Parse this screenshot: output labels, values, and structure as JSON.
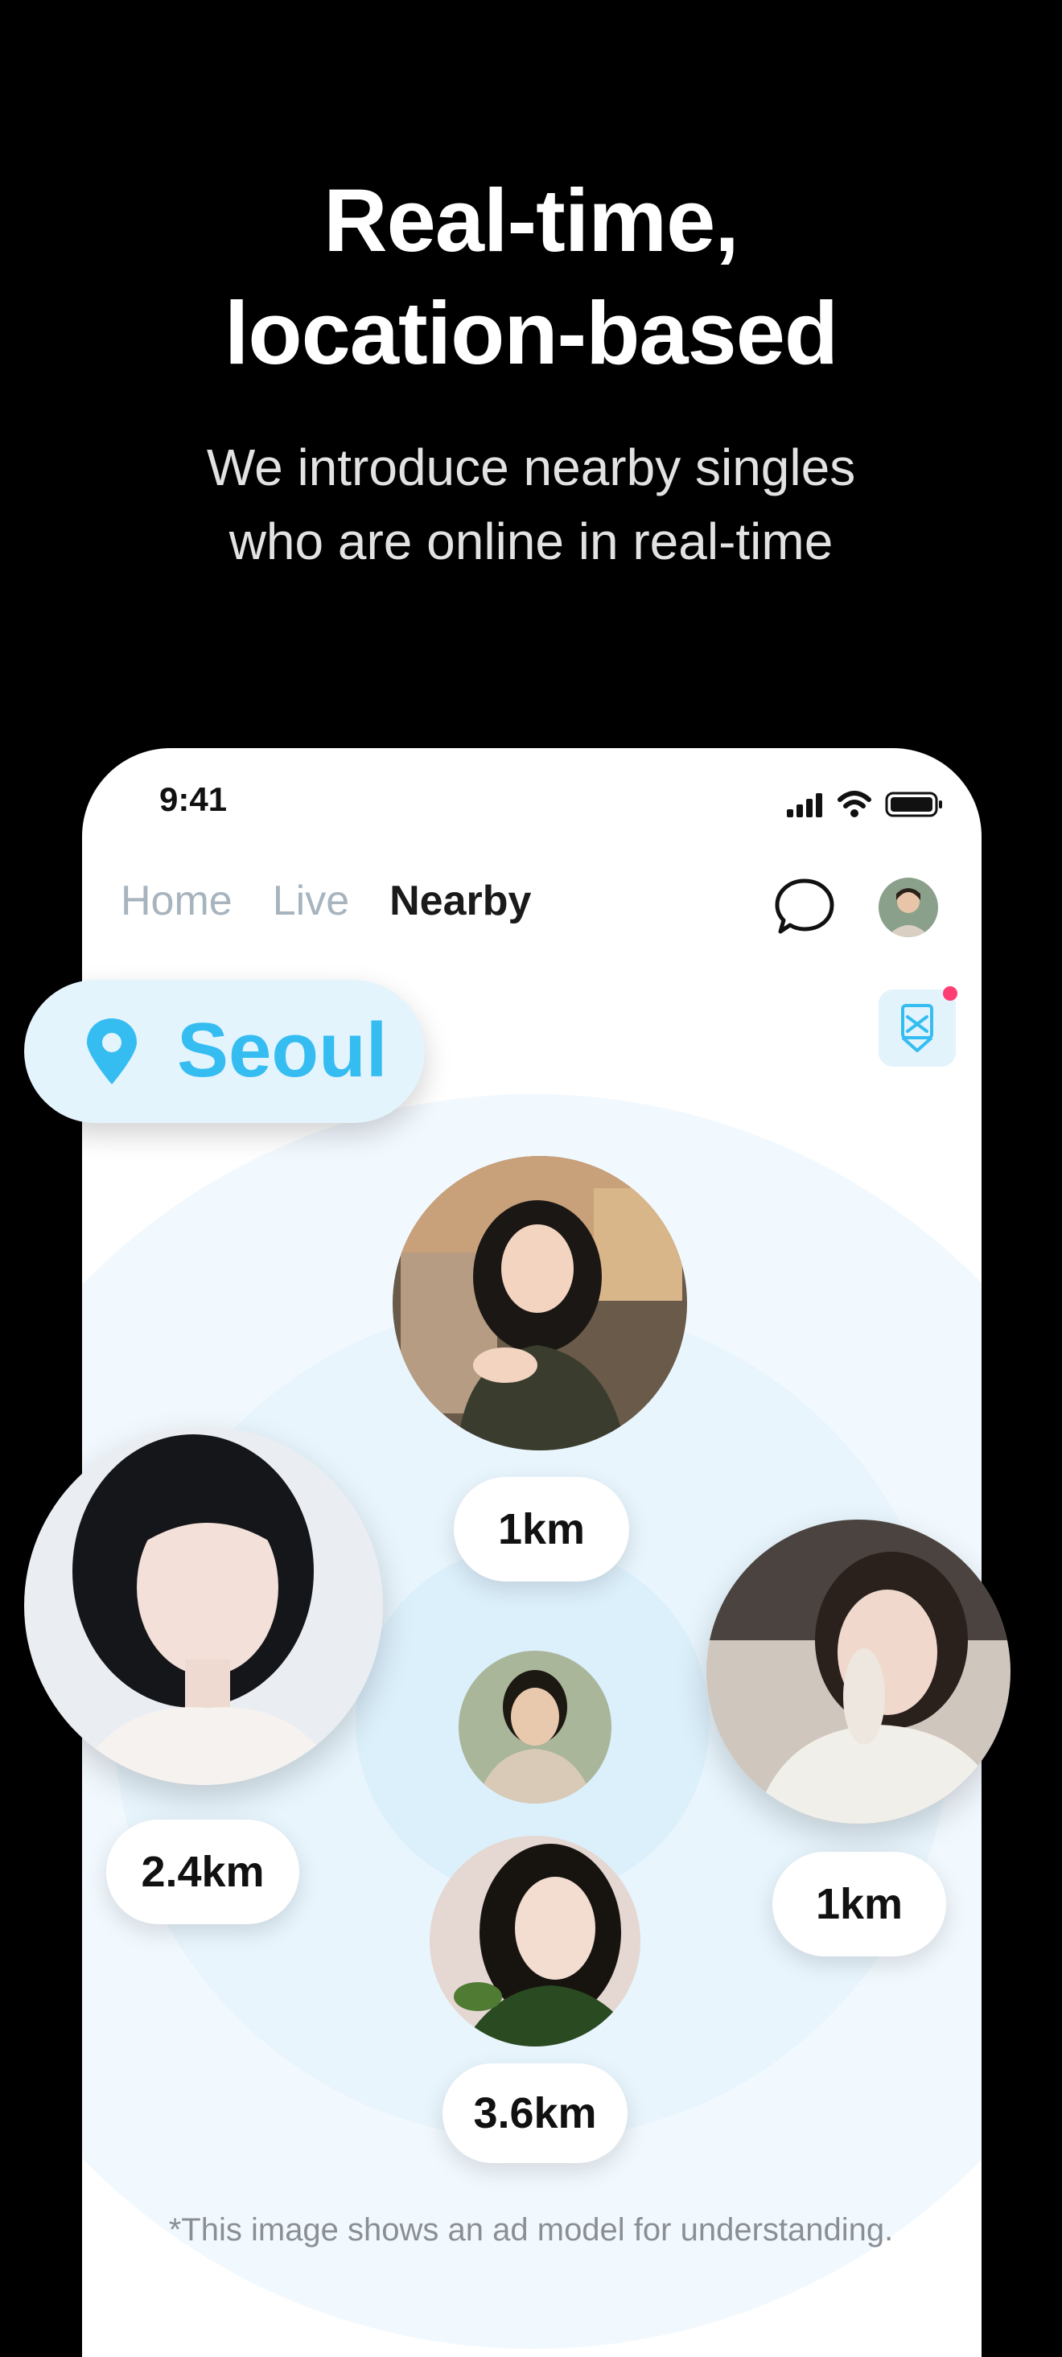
{
  "headline": {
    "line1": "Real-time,",
    "line2": "location-based"
  },
  "subheadline": {
    "line1": "We introduce nearby singles",
    "line2": "who are online in real-time"
  },
  "status_bar": {
    "time": "9:41"
  },
  "nav": {
    "tabs": [
      {
        "label": "Home",
        "active": false
      },
      {
        "label": "Live",
        "active": false
      },
      {
        "label": "Nearby",
        "active": true
      }
    ]
  },
  "location": {
    "city": "Seoul",
    "icon": "map-pin-icon"
  },
  "profiles": [
    {
      "name": "top-profile",
      "distance": "1km"
    },
    {
      "name": "left-profile",
      "distance": "2.4km"
    },
    {
      "name": "right-profile",
      "distance": "1km"
    },
    {
      "name": "bottom-profile",
      "distance": "3.6km"
    }
  ],
  "disclaimer": "*This image shows an ad model for understanding.",
  "colors": {
    "accent": "#35bdf2",
    "pill_bg": "#e4f4fd",
    "radar_bg": "#f2f9fe",
    "notification_dot": "#ff3d72"
  }
}
